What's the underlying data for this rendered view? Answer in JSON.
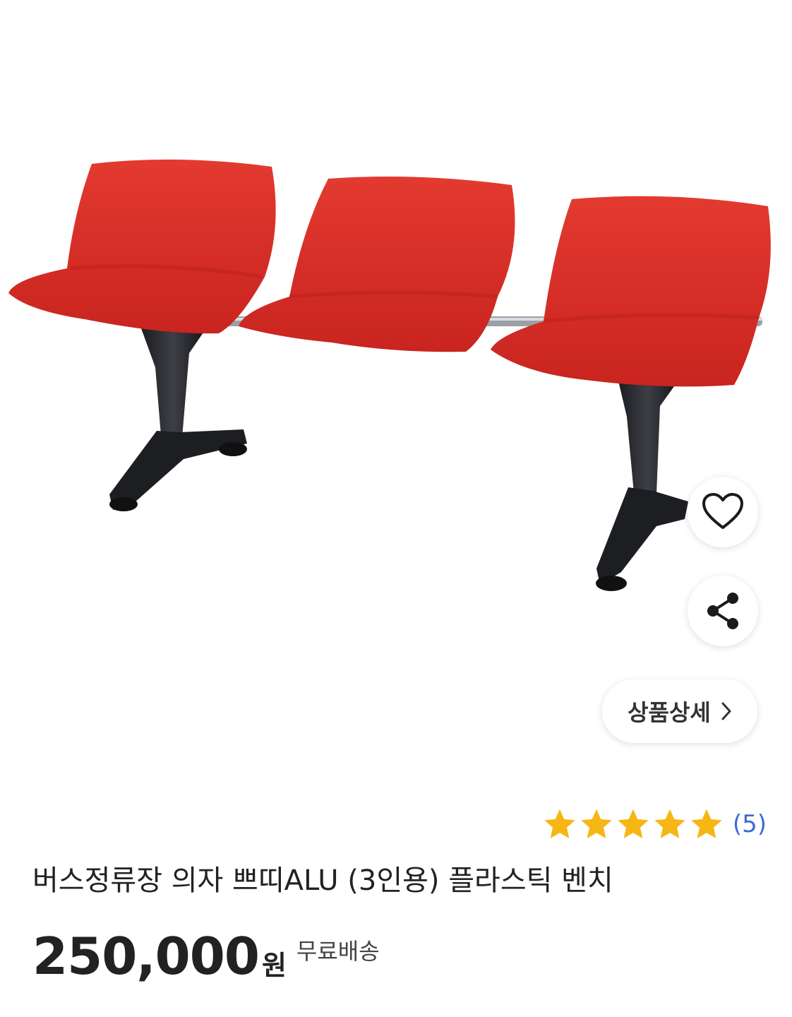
{
  "product": {
    "detail_button_label": "상품상세",
    "title": "버스정류장 의자 쁘띠ALU (3인용) 플라스틱 벤치",
    "price": "250,000",
    "currency": "원",
    "shipping": "무료배송",
    "rating": {
      "stars": 5,
      "review_count": "(5)"
    }
  },
  "icons": {
    "wishlist": "heart-outline-icon",
    "share": "share-icon",
    "detail_chevron": "chevron-right-icon"
  },
  "colors": {
    "seat": "#d8322b",
    "frame": "#222428",
    "star": "#f6b613",
    "review_link": "#3d6ad6",
    "text": "#222222"
  }
}
